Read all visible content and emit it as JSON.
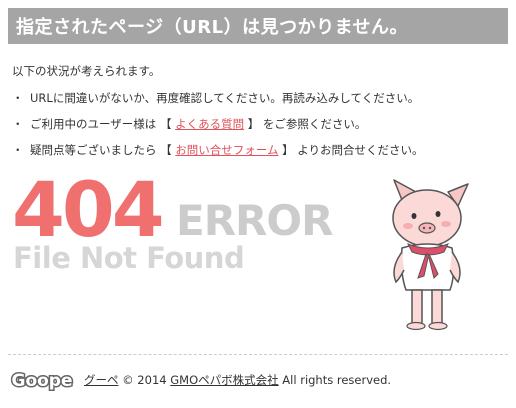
{
  "header": {
    "title": "指定されたページ（URL）は見つかりません。"
  },
  "intro": "以下の状況が考えられます。",
  "bullets": [
    {
      "marker": "・",
      "text": "URLに間違いがないか、再度確認してください。再読み込みしてください。"
    },
    {
      "marker": "・",
      "prefix": "ご利用中のユーザー様は",
      "open": "【",
      "link": "よくある質問",
      "close": "】",
      "suffix": "をご参照ください。"
    },
    {
      "marker": "・",
      "prefix": "疑問点等ございましたら",
      "open": "【",
      "link": "お問い合せフォーム",
      "close": "】",
      "suffix": "よりお問合せください。"
    }
  ],
  "hero": {
    "code": "404",
    "word": "ERROR",
    "subtitle": "File Not Found"
  },
  "footer": {
    "service_link": "グーペ",
    "copyright": "© 2014",
    "company_link": "GMOペパボ株式会社",
    "rights": "All rights reserved.",
    "logo_text": "Goope"
  },
  "colors": {
    "header_bg": "#a5a5a5",
    "accent_red": "#f07070",
    "link_red": "#e0525a",
    "muted_gray": "#cccccc"
  },
  "icons": {
    "mascot": "pig-mascot-icon",
    "logo": "goope-logo-icon"
  }
}
